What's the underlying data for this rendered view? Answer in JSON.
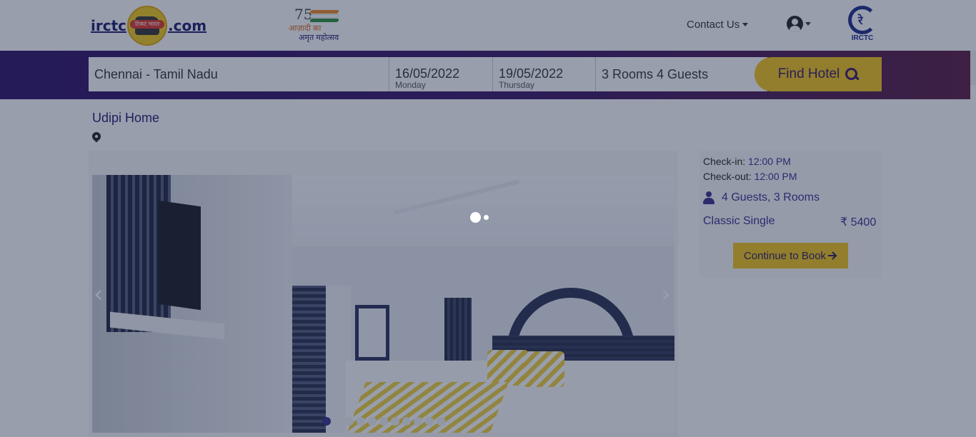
{
  "header": {
    "logo_left": {
      "prefix": "irctc",
      "suffix": ".com",
      "badge_text": "टिकट भारत"
    },
    "azadi": {
      "number": "75",
      "line1": "आज़ादी का",
      "line2": "अमृत महोत्सव"
    },
    "contact_label": "Contact Us",
    "logo_right_text": "IRCTC",
    "logo_right_emblem": "रे"
  },
  "search": {
    "destination": "Chennai - Tamil Nadu",
    "checkin_date": "16/05/2022",
    "checkin_day": "Monday",
    "checkout_date": "19/05/2022",
    "checkout_day": "Thursday",
    "rooms_guests": "3 Rooms 4 Guests",
    "find_label": "Find Hotel"
  },
  "hotel": {
    "name": "Udipi Home",
    "gallery": {
      "prev": "‹",
      "next": "›",
      "dot_count": 11,
      "active_index": 0
    }
  },
  "booking": {
    "checkin_label": "Check-in:",
    "checkin_time": "12:00 PM",
    "checkout_label": "Check-out:",
    "checkout_time": "12:00 PM",
    "guests_rooms": "4 Guests, 3 Rooms",
    "room_type": "Classic Single",
    "price": "₹ 5400",
    "continue_label": "Continue to Book"
  },
  "icons": [
    "user-icon",
    "search-icon",
    "map-pin-icon",
    "person-icon",
    "arrow-right-icon",
    "caret-down-icon"
  ],
  "colors": {
    "brand_purple": "#3a1466",
    "accent_yellow": "#f5c518",
    "text_indigo": "#3a2f8e"
  }
}
